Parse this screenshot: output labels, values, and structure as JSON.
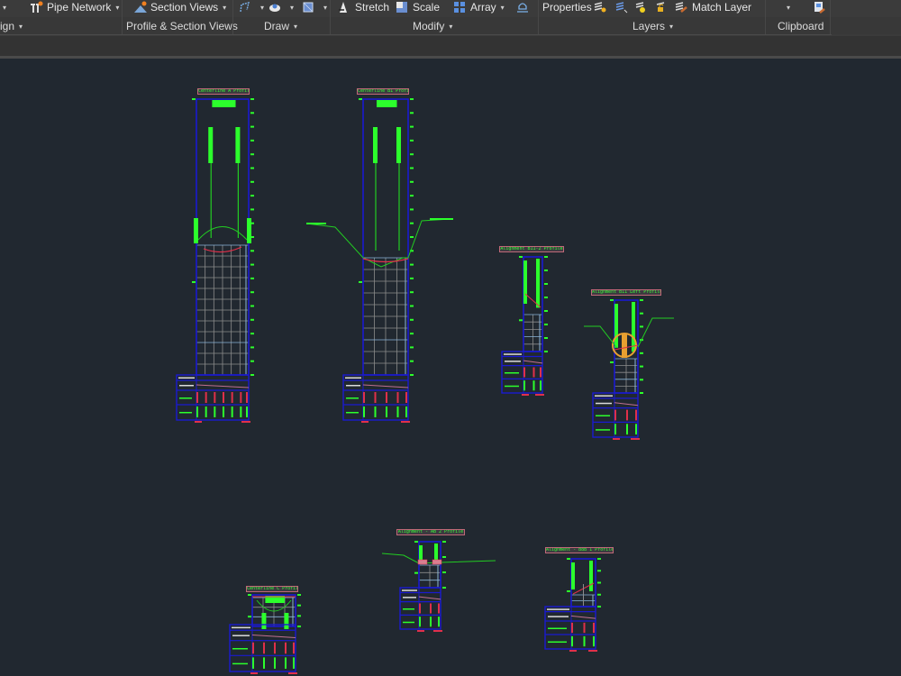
{
  "ribbon": {
    "row1": [
      {
        "name": "cut-left-caret",
        "label": ""
      },
      {
        "name": "pipe-network-button",
        "label": "Pipe Network",
        "icon": "pipe-network-icon",
        "dropdown": true
      },
      {
        "name": "section-views-button",
        "label": "Section Views",
        "icon": "section-views-icon",
        "dropdown": true
      },
      {
        "name": "polyline-button",
        "label": "",
        "icon": "polyline-icon",
        "dropdown": true
      },
      {
        "name": "hatch-button",
        "label": "",
        "icon": "circle-icon",
        "dropdown": true
      },
      {
        "name": "rectangle-button",
        "label": "",
        "icon": "rectangle-icon",
        "dropdown": true
      },
      {
        "name": "stretch-button",
        "label": "Stretch",
        "icon": "stretch-icon"
      },
      {
        "name": "scale-button",
        "label": "Scale",
        "icon": "scale-icon"
      },
      {
        "name": "array-button",
        "label": "Array",
        "icon": "array-icon",
        "dropdown": true
      },
      {
        "name": "offset-button",
        "label": "",
        "icon": "offset-icon"
      },
      {
        "name": "properties-button",
        "label": "Properties"
      },
      {
        "name": "layer-properties-button",
        "label": "",
        "icon": "layer-state-icon"
      },
      {
        "name": "layer-isolate-button",
        "label": "",
        "icon": "layer-iso-icon"
      },
      {
        "name": "layer-freeze-button",
        "label": "",
        "icon": "layer-freeze-icon"
      },
      {
        "name": "layer-lock-button",
        "label": "",
        "icon": "layer-lock-icon"
      },
      {
        "name": "match-layer-button",
        "label": "Match Layer",
        "icon": "match-layer-icon"
      },
      {
        "name": "clipboard-dropdown",
        "label": "",
        "dropdown": true
      },
      {
        "name": "paste-button",
        "label": "",
        "icon": "paste-icon"
      }
    ],
    "panels": {
      "design": "ign",
      "profile_section": "Profile & Section Views",
      "draw": "Draw",
      "modify": "Modify",
      "layers": "Layers",
      "clipboard": "Clipboard"
    }
  },
  "canvas": {
    "background": "#212830",
    "profiles": [
      {
        "id": "p1",
        "title": "Centerline A Profile"
      },
      {
        "id": "p2",
        "title": "Centerline B1 Profile"
      },
      {
        "id": "p3",
        "title": "Alignment B11-2 Profile"
      },
      {
        "id": "p4",
        "title": "Alignment B11 Left Profile"
      },
      {
        "id": "p5",
        "title": "Centerline C Profile"
      },
      {
        "id": "p6",
        "title": "Alignment - AB 2 Profile"
      },
      {
        "id": "p7",
        "title": "Alignment - B8B 1 Profile"
      }
    ],
    "band_labels": {
      "datum": "Datum Elev",
      "design": "Design Levels",
      "ground": "Ground Levels"
    },
    "colors": {
      "frame": "#1a1ad0",
      "grid": "#8c8c8c",
      "grid_accent": "#8ab4d8",
      "text": "#2cff2c",
      "design_line": "#e0304a",
      "annotation": "#22cc22",
      "marker": "#e8a030"
    }
  }
}
